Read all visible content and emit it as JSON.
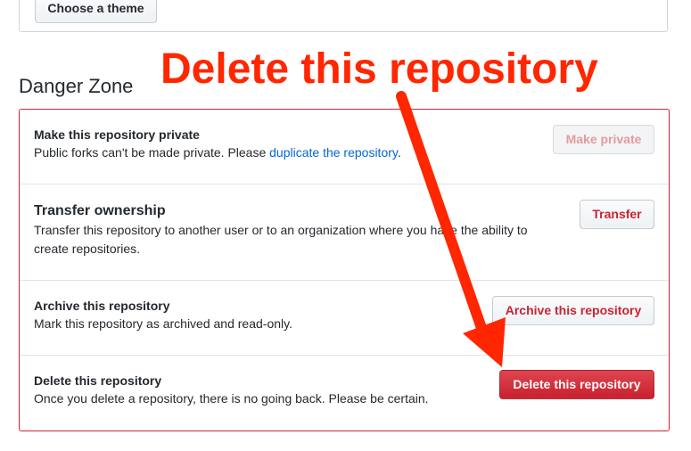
{
  "theme": {
    "choose_theme_label": "Choose a theme"
  },
  "danger_zone": {
    "heading": "Danger Zone",
    "accent_color": "#cb2431",
    "rows": [
      {
        "title": "Make this repository private",
        "description_prefix": "Public forks can't be made private. Please ",
        "description_link": "duplicate the repository",
        "description_suffix": ".",
        "button_label": "Make private",
        "button_disabled": true
      },
      {
        "title": "Transfer ownership",
        "description": "Transfer this repository to another user or to an organization where you have the ability to create repositories.",
        "button_label": "Transfer"
      },
      {
        "title": "Archive this repository",
        "description": "Mark this repository as archived and read-only.",
        "button_label": "Archive this repository"
      },
      {
        "title": "Delete this repository",
        "description": "Once you delete a repository, there is no going back. Please be certain.",
        "button_label": "Delete this repository"
      }
    ]
  },
  "annotation": {
    "text": "Delete this repository",
    "color": "#ff2600",
    "icon": "arrow-down-icon"
  }
}
